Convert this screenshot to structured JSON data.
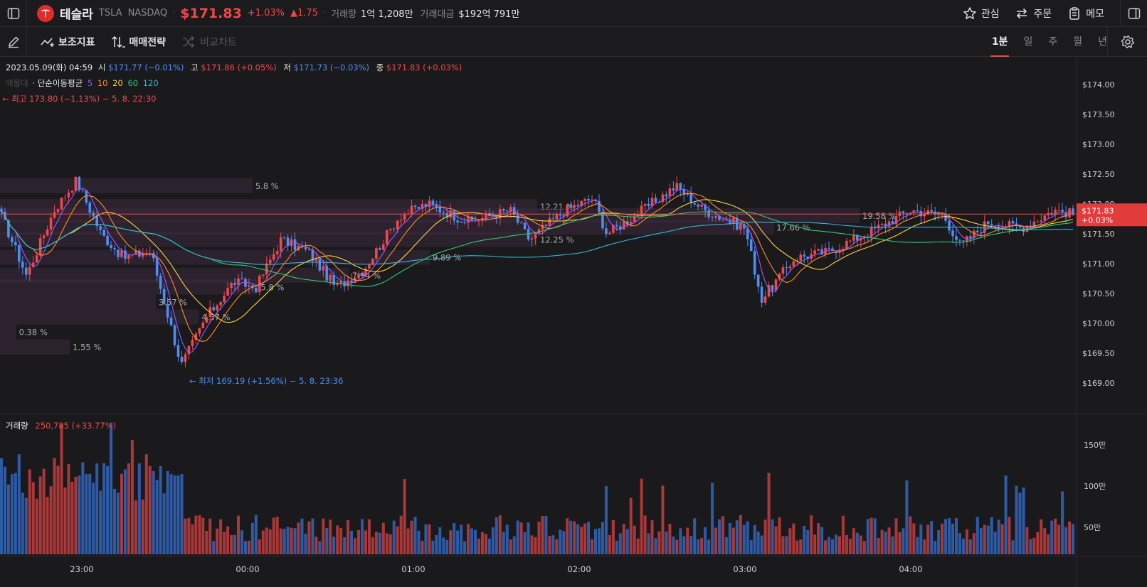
{
  "header": {
    "name": "테슬라",
    "ticker": "TSLA",
    "exchange": "NASDAQ",
    "price": "$171.83",
    "change_pct": "+1.03%",
    "change_abs": "▲1.75",
    "volume_label": "거래량",
    "volume_value": "1억 1,208만",
    "turnover_label": "거래대금",
    "turnover_value": "$192억 791만",
    "menu": [
      {
        "label": "관심",
        "icon": "star-icon"
      },
      {
        "label": "주문",
        "icon": "swap-icon"
      },
      {
        "label": "메모",
        "icon": "clipboard-icon"
      }
    ]
  },
  "toolbar": {
    "indicators_label": "보조지표",
    "strategy_label": "매매전략",
    "compare_label": "비교차트",
    "intervals": [
      "1분",
      "일",
      "주",
      "월",
      "년"
    ],
    "active_interval": "1분"
  },
  "info": {
    "date": "2023.05.09(화) 04:59",
    "open_label": "시",
    "open_value": "$171.77 (−0.01%)",
    "high_label": "고",
    "high_value": "$171.86 (+0.05%)",
    "low_label": "저",
    "low_value": "$171.73 (−0.03%)",
    "close_label": "종",
    "close_value": "$171.83 (+0.03%)",
    "profile_label": "매물대",
    "ma_label": "· 단순이동평균",
    "ma_periods": [
      "5",
      "10",
      "20",
      "60",
      "120"
    ],
    "high_marker": "← 최고 173.80 (−1.13%) − 5. 8. 22:30",
    "low_marker": "← 최저 169.19 (+1.56%) − 5. 8. 23:36",
    "last_price_tag": "$171.83",
    "last_change_tag": "+0.03%"
  },
  "volume_panel": {
    "label": "거래량",
    "value": "250,785 (+33.77%)"
  },
  "colors": {
    "up": "#f04848",
    "down": "#4b8ef5",
    "ma5": "#9b59ff",
    "ma10": "#ff8c2a",
    "ma20": "#ffd23f",
    "ma60": "#2ecc71",
    "ma120": "#37b3d8"
  },
  "chart_data": {
    "type": "candlestick",
    "y_axis": {
      "min": 169.0,
      "max": 174.0,
      "ticks": [
        "$174.00",
        "$173.50",
        "$173.00",
        "$172.50",
        "$172.00",
        "$171.50",
        "$171.00",
        "$170.50",
        "$170.00",
        "$169.50",
        "$169.00"
      ]
    },
    "volume_axis_ticks": [
      "150만",
      "100만",
      "50만"
    ],
    "x_ticks": [
      "23:00",
      "00:00",
      "01:00",
      "02:00",
      "03:00",
      "04:00"
    ],
    "price_anchors": [
      {
        "t": "22:30",
        "p": 171.9
      },
      {
        "t": "22:40",
        "p": 170.8
      },
      {
        "t": "22:50",
        "p": 171.9
      },
      {
        "t": "22:58",
        "p": 172.4
      },
      {
        "t": "23:07",
        "p": 171.5
      },
      {
        "t": "23:15",
        "p": 171.1
      },
      {
        "t": "23:25",
        "p": 171.2
      },
      {
        "t": "23:36",
        "p": 169.3
      },
      {
        "t": "23:45",
        "p": 170.1
      },
      {
        "t": "23:55",
        "p": 170.7
      },
      {
        "t": "00:03",
        "p": 170.6
      },
      {
        "t": "00:12",
        "p": 171.4
      },
      {
        "t": "00:22",
        "p": 171.2
      },
      {
        "t": "00:32",
        "p": 170.6
      },
      {
        "t": "00:42",
        "p": 170.9
      },
      {
        "t": "00:55",
        "p": 171.8
      },
      {
        "t": "01:05",
        "p": 172.0
      },
      {
        "t": "01:20",
        "p": 171.7
      },
      {
        "t": "01:35",
        "p": 171.9
      },
      {
        "t": "01:42",
        "p": 171.4
      },
      {
        "t": "01:55",
        "p": 171.9
      },
      {
        "t": "02:05",
        "p": 172.1
      },
      {
        "t": "02:10",
        "p": 171.5
      },
      {
        "t": "02:20",
        "p": 171.8
      },
      {
        "t": "02:35",
        "p": 172.3
      },
      {
        "t": "02:45",
        "p": 171.9
      },
      {
        "t": "03:00",
        "p": 171.6
      },
      {
        "t": "03:06",
        "p": 170.4
      },
      {
        "t": "03:18",
        "p": 171.1
      },
      {
        "t": "03:30",
        "p": 171.2
      },
      {
        "t": "03:48",
        "p": 171.6
      },
      {
        "t": "04:00",
        "p": 171.9
      },
      {
        "t": "04:12",
        "p": 171.8
      },
      {
        "t": "04:18",
        "p": 171.3
      },
      {
        "t": "04:28",
        "p": 171.7
      },
      {
        "t": "04:40",
        "p": 171.6
      },
      {
        "t": "04:52",
        "p": 171.9
      },
      {
        "t": "04:59",
        "p": 171.83
      }
    ],
    "profile": [
      {
        "pct": "5.8 %",
        "price": 172.3,
        "weight": 0.47
      },
      {
        "pct": "12.21 %",
        "price": 171.95,
        "weight": 1.0
      },
      {
        "pct": "19.58 %",
        "price": 171.8,
        "weight": 1.6
      },
      {
        "pct": "17.66 %",
        "price": 171.6,
        "weight": 1.44
      },
      {
        "pct": "12.25 %",
        "price": 171.4,
        "weight": 1.0
      },
      {
        "pct": "9.89 %",
        "price": 171.1,
        "weight": 0.8
      },
      {
        "pct": "7.94 %",
        "price": 170.8,
        "weight": 0.65
      },
      {
        "pct": "5.8 %",
        "price": 170.6,
        "weight": 0.48
      },
      {
        "pct": "3.57 %",
        "price": 170.35,
        "weight": 0.29
      },
      {
        "pct": "4.57 %",
        "price": 170.1,
        "weight": 0.37
      },
      {
        "pct": "0.38 %",
        "price": 169.85,
        "weight": 0.03
      },
      {
        "pct": "1.55 %",
        "price": 169.6,
        "weight": 0.13
      }
    ]
  }
}
